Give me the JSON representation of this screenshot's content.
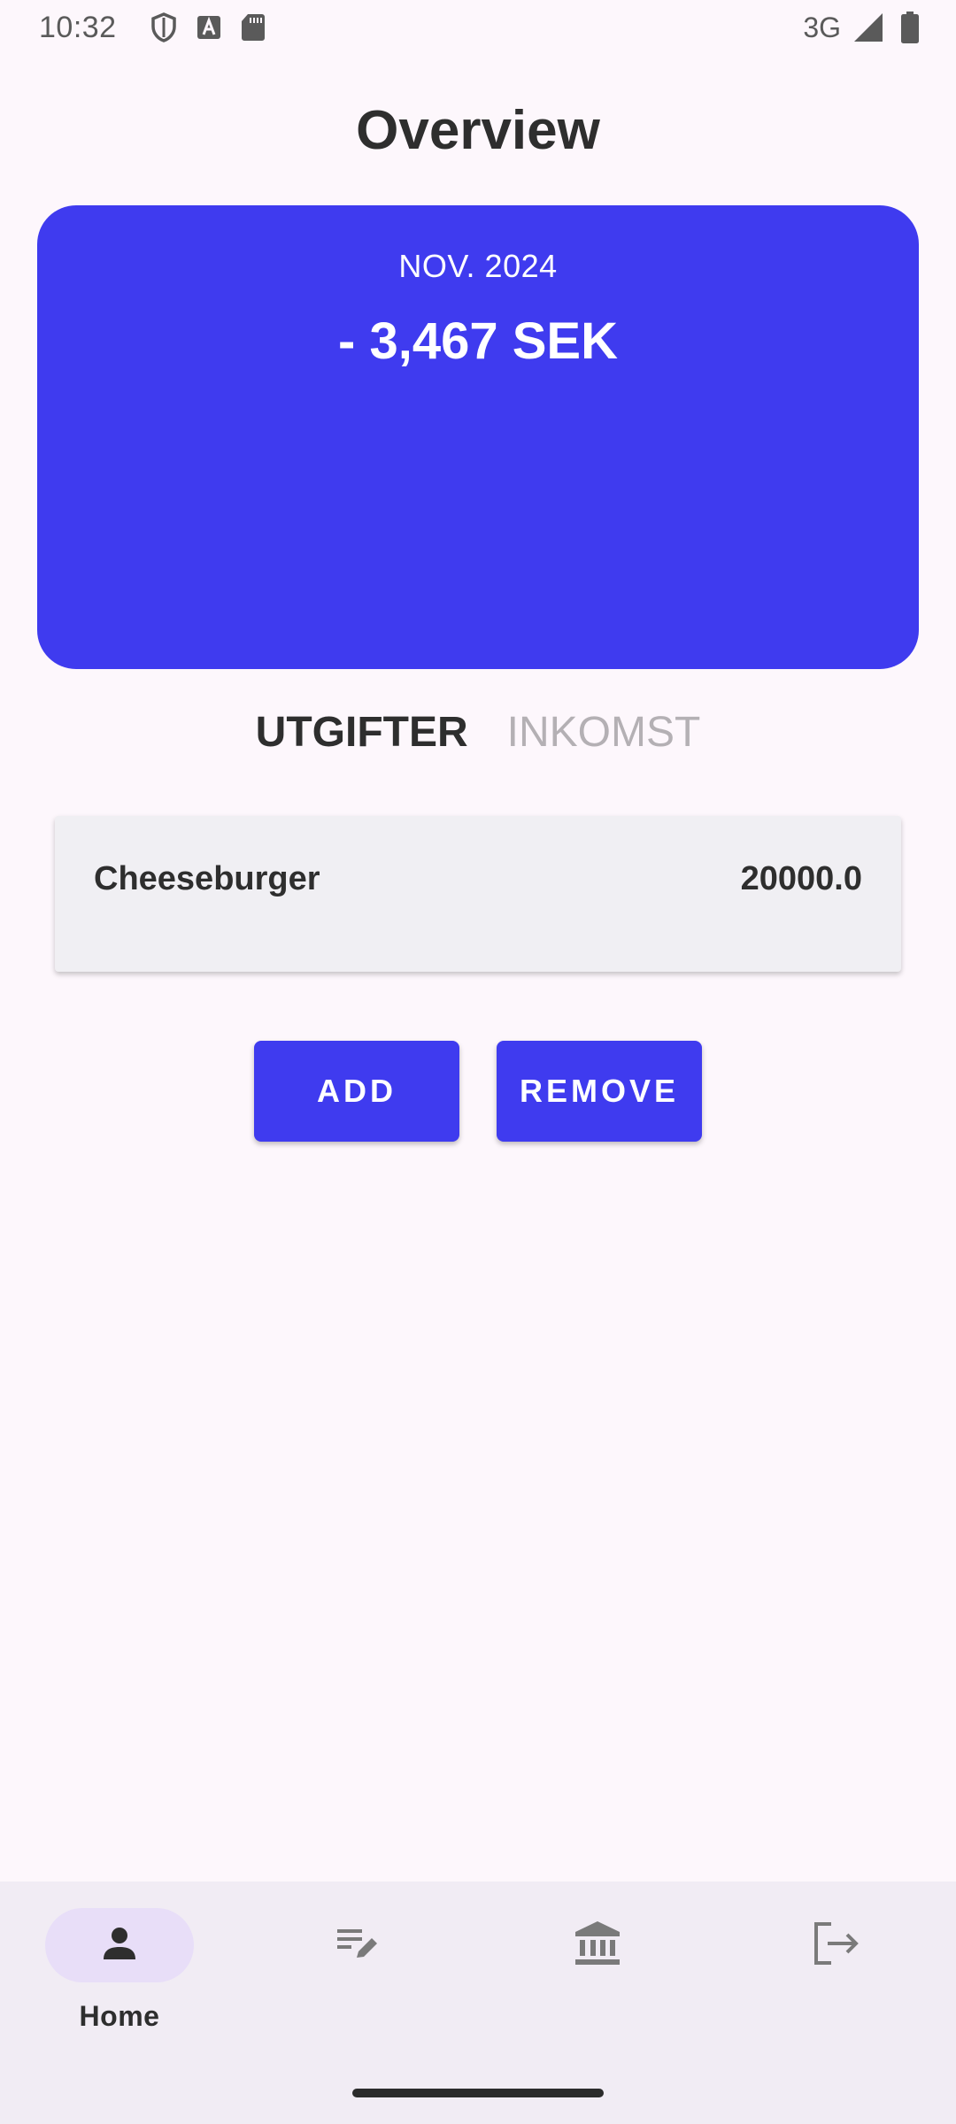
{
  "status_bar": {
    "time": "10:32",
    "network": "3G",
    "icons": [
      "shield-icon",
      "font-a-icon",
      "sd-card-icon",
      "signal-icon",
      "battery-icon"
    ]
  },
  "page": {
    "title": "Overview"
  },
  "summary": {
    "month": "NOV. 2024",
    "total": "- 3,467 SEK",
    "card_color": "#3f3bef"
  },
  "tabs": [
    {
      "label": "UTGIFTER",
      "active": true
    },
    {
      "label": "INKOMST",
      "active": false
    }
  ],
  "entries": [
    {
      "name": "Cheeseburger",
      "amount": "20000.0"
    }
  ],
  "actions": {
    "add_label": "ADD",
    "remove_label": "REMOVE"
  },
  "bottom_nav": {
    "items": [
      {
        "label": "Home",
        "icon": "person-icon",
        "active": true
      },
      {
        "label": "",
        "icon": "edit-list-icon",
        "active": false
      },
      {
        "label": "",
        "icon": "bank-icon",
        "active": false
      },
      {
        "label": "",
        "icon": "logout-icon",
        "active": false
      }
    ]
  },
  "colors": {
    "accent": "#3f3bef",
    "background": "#fdf7fc",
    "nav_background": "#f1ecf4",
    "nav_active_pill": "#e8def8"
  }
}
